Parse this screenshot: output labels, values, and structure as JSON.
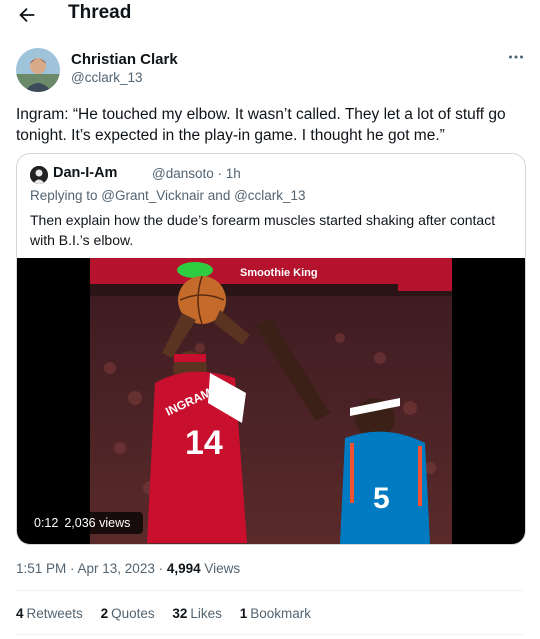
{
  "header": {
    "title": "Thread"
  },
  "tweet": {
    "author_name": "Christian Clark",
    "author_handle": "@cclark_13",
    "text": "Ingram: “He touched my elbow. It wasn’t called. They let a lot of stuff go tonight. It’s expected in the play-in game. I thought he got me.”",
    "timestamp": "1:51 PM · Apr 13, 2023 · ",
    "views_count": "4,994",
    "views_label": "Views"
  },
  "quote": {
    "author_name": "Dan-I-Am",
    "author_handle": "@dansoto",
    "time": "· 1h",
    "replying_prefix": "Replying to ",
    "replying_to_1": "@Grant_Vicknair",
    "replying_and": " and ",
    "replying_to_2": "@cclark_13",
    "text": "Then explain how the dude’s forearm muscles started shaking after contact with B.I.’s elbow.",
    "video": {
      "duration": "0:12",
      "views": "2,036 views",
      "banner_text_1": "Smoothie King",
      "jersey_name": "INGRAM",
      "jersey_number": "14",
      "opponent_number": "5"
    }
  },
  "stats": {
    "retweets_count": "4",
    "retweets_label": "Retweets",
    "quotes_count": "2",
    "quotes_label": "Quotes",
    "likes_count": "32",
    "likes_label": "Likes",
    "bookmarks_count": "1",
    "bookmarks_label": "Bookmark"
  },
  "colors": {
    "secondary_text": "#536471",
    "border": "#cfd9de",
    "pelicans_red": "#c8102e",
    "thunder_blue": "#007ac1"
  }
}
